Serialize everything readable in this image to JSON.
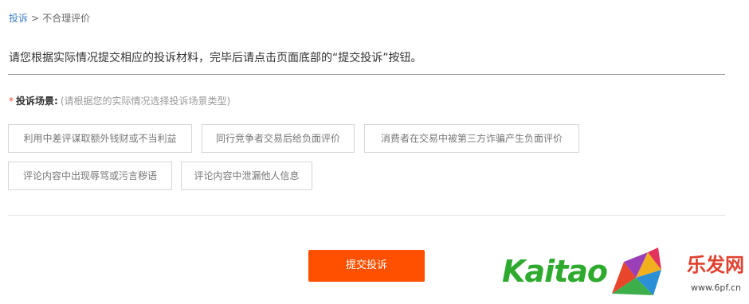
{
  "breadcrumb": {
    "link": "投诉",
    "separator": ">",
    "current": "不合理评价"
  },
  "instruction": "请您根据实际情况提交相应的投诉材料，完毕后请点击页面底部的“提交投诉”按钮。",
  "scenario": {
    "required_mark": "*",
    "label": "投诉场景:",
    "hint": "(请根据您的实际情况选择投诉场景类型)",
    "options": [
      "利用中差评谋取额外钱财或不当利益",
      "同行竞争者交易后给负面评价",
      "消费者在交易中被第三方诈骗产生负面评价",
      "评论内容中出现辱骂或污言秽语",
      "评论内容中泄漏他人信息"
    ]
  },
  "submit_label": "提交投诉",
  "watermark": {
    "brand": "Kaitao",
    "cn": "乐发网",
    "url": "www.6pf.cn"
  },
  "colors": {
    "accent": "#ff5000",
    "link": "#3b7cc4",
    "required": "#e64b2f"
  }
}
